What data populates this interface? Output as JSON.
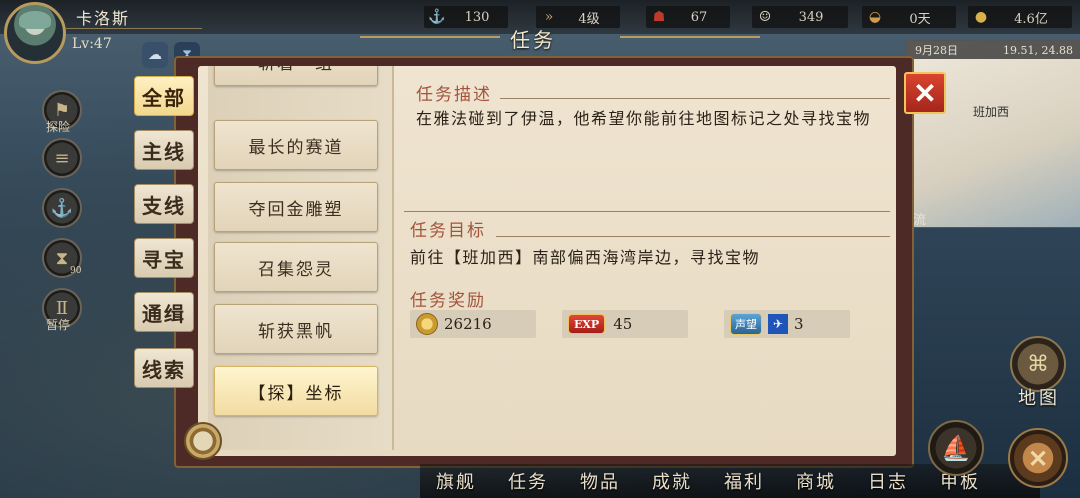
{
  "player": {
    "name": "卡洛斯",
    "level": "Lv:47"
  },
  "resources": [
    {
      "icon": "oar-icon",
      "glyph": "⚓",
      "value": "130"
    },
    {
      "icon": "speed-arrows-icon",
      "glyph": "»",
      "value": "4级"
    },
    {
      "icon": "crew-icon",
      "glyph": "☗",
      "value": "67"
    },
    {
      "icon": "sailor-icon",
      "glyph": "☺",
      "value": "349"
    },
    {
      "icon": "bread-icon",
      "glyph": "◒",
      "value": "0天"
    },
    {
      "icon": "gold-coin-icon",
      "glyph": "●",
      "value": "4.6亿"
    }
  ],
  "side_menu": [
    {
      "icon": "explore-icon",
      "label": "探险"
    },
    {
      "icon": "scroll-icon",
      "label": ""
    },
    {
      "icon": "anchor-icon",
      "label": ""
    },
    {
      "icon": "hourglass-icon",
      "label": "",
      "badge": "90"
    },
    {
      "icon": "pause-icon",
      "label": "暂停"
    }
  ],
  "minimap": {
    "date": "9月28日",
    "coords": "19.51, 24.88",
    "place": "班加西",
    "label": "流"
  },
  "panel": {
    "title": "任务",
    "close_glyph": "✕",
    "categories": [
      {
        "label": "全部",
        "active": true
      },
      {
        "label": "主线",
        "active": false
      },
      {
        "label": "支线",
        "active": false
      },
      {
        "label": "寻宝",
        "active": false
      },
      {
        "label": "通缉",
        "active": false
      },
      {
        "label": "线索",
        "active": false
      }
    ],
    "quests": [
      {
        "label": "斩着一组",
        "active": false
      },
      {
        "label": "最长的赛道",
        "active": false
      },
      {
        "label": "夺回金雕塑",
        "active": false
      },
      {
        "label": "召集怨灵",
        "active": false
      },
      {
        "label": "斩获黑帆",
        "active": false
      },
      {
        "label": "【探】坐标",
        "active": true
      }
    ],
    "description_title": "任务描述",
    "description": "在雅法碰到了伊温，他希望你能前往地图标记之处寻找宝物",
    "goal_title": "任务目标",
    "goal": "前往【班加西】南部偏西海湾岸边，寻找宝物",
    "rewards_title": "任务奖励",
    "rewards": [
      {
        "icon": "gold-coin-icon",
        "value": "26216"
      },
      {
        "icon": "exp-icon",
        "badge": "EXP",
        "value": "45"
      },
      {
        "icon": "reputation-icon",
        "badge": "声望",
        "value": "3"
      }
    ]
  },
  "bottom_nav": [
    "旗舰",
    "任务",
    "物品",
    "成就",
    "福利",
    "商城",
    "日志",
    "甲板"
  ],
  "map_button": {
    "label": "地图"
  }
}
